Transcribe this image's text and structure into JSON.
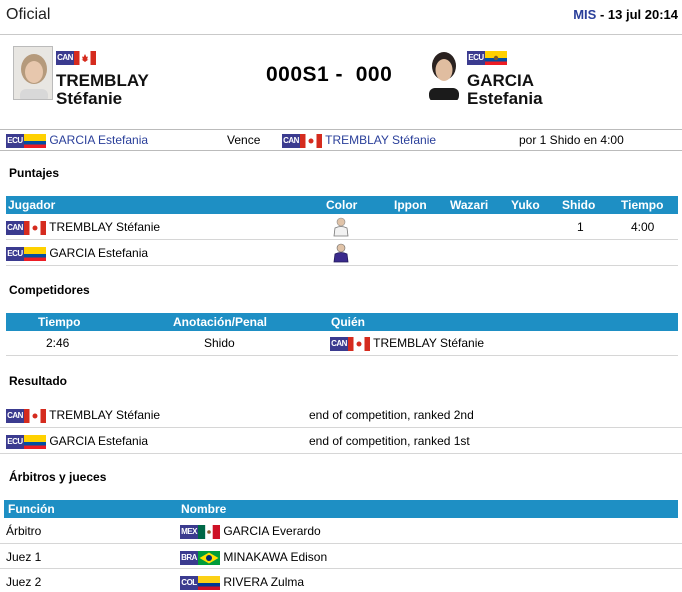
{
  "header": {
    "title": "Oficial",
    "event_code": "MIS",
    "datetime": "13 jul 20:14"
  },
  "match": {
    "left": {
      "country": "CAN",
      "surname": "TREMBLAY",
      "firstname": "Stéfanie"
    },
    "right": {
      "country": "ECU",
      "surname": "GARCIA",
      "firstname": "Estefania"
    },
    "score_left": "000S1 -",
    "score_right": "000"
  },
  "result_line": {
    "winner_country": "ECU",
    "winner": "GARCIA Estefania",
    "verb": "Vence",
    "loser_country": "CAN",
    "loser": "TREMBLAY Stéfanie",
    "method": "por 1 Shido en 4:00"
  },
  "puntajes": {
    "heading": "Puntajes",
    "columns": [
      "Jugador",
      "Color",
      "Ippon",
      "Wazari",
      "Yuko",
      "Shido",
      "Tiempo"
    ],
    "rows": [
      {
        "country": "CAN",
        "name": "TREMBLAY Stéfanie",
        "color": "white",
        "ippon": "",
        "wazari": "",
        "yuko": "",
        "shido": "1",
        "tiempo": "4:00"
      },
      {
        "country": "ECU",
        "name": "GARCIA Estefania",
        "color": "blue",
        "ippon": "",
        "wazari": "",
        "yuko": "",
        "shido": "",
        "tiempo": ""
      }
    ]
  },
  "competidores": {
    "heading": "Competidores",
    "columns": [
      "Tiempo",
      "Anotación/Penal",
      "Quién"
    ],
    "rows": [
      {
        "tiempo": "2:46",
        "anotacion": "Shido",
        "country": "CAN",
        "quien": "TREMBLAY Stéfanie"
      }
    ]
  },
  "resultado": {
    "heading": "Resultado",
    "rows": [
      {
        "country": "CAN",
        "name": "TREMBLAY Stéfanie",
        "result": "end of competition, ranked 2nd"
      },
      {
        "country": "ECU",
        "name": "GARCIA Estefania",
        "result": "end of competition, ranked 1st"
      }
    ]
  },
  "arbitros": {
    "heading": "Árbitros y jueces",
    "columns": [
      "Función",
      "Nombre"
    ],
    "rows": [
      {
        "funcion": "Árbitro",
        "country": "MEX",
        "nombre": "GARCIA Everardo"
      },
      {
        "funcion": "Juez 1",
        "country": "BRA",
        "nombre": "MINAKAWA Edison"
      },
      {
        "funcion": "Juez 2",
        "country": "COL",
        "nombre": "RIVERA Zulma"
      }
    ]
  },
  "colors": {
    "header_bar": "#1e8fc4",
    "link": "#2a3f9a"
  }
}
